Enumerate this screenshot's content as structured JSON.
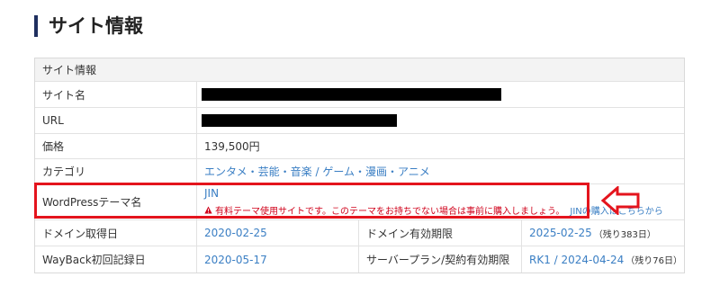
{
  "page": {
    "title": "サイト情報"
  },
  "table": {
    "header": "サイト情報",
    "site_name": {
      "label": "サイト名"
    },
    "url": {
      "label": "URL"
    },
    "price": {
      "label": "価格",
      "value": "139,500円"
    },
    "category": {
      "label": "カテゴリ",
      "value": "エンタメ・芸能・音楽 / ゲーム・漫画・アニメ"
    },
    "theme": {
      "label": "WordPressテーマ名",
      "value": "JIN",
      "warning": "有料テーマ使用サイトです。このテーマをお持ちでない場合は事前に購入しましょう。",
      "purchase_link": "JINの購入はこちらから"
    },
    "domain": {
      "acquired_label": "ドメイン取得日",
      "acquired_value": "2020-02-25",
      "expiry_label": "ドメイン有効期限",
      "expiry_value": "2025-02-25",
      "expiry_remaining": "（残り383日）"
    },
    "wayback": {
      "label": "WayBack初回記録日",
      "value": "2020-05-17",
      "plan_label": "サーバープラン/契約有効期限",
      "plan_value": "RK1 / 2024-04-24",
      "plan_remaining": "（残り76日）"
    }
  },
  "colors": {
    "title_accent": "#1f2f5f",
    "link": "#3b7fc4",
    "warning": "#d0021b",
    "highlight": "#e4141d"
  },
  "icons": {
    "warning": "warning-triangle-icon",
    "annotation": "left-arrow-icon"
  }
}
